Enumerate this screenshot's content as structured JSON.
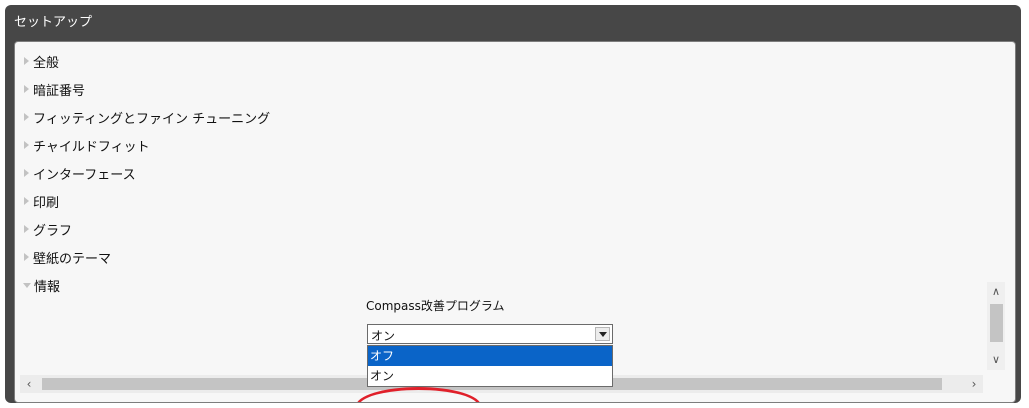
{
  "window": {
    "title": "セットアップ"
  },
  "menu": {
    "items": [
      {
        "label": "全般",
        "expanded": false
      },
      {
        "label": "暗証番号",
        "expanded": false
      },
      {
        "label": "フィッティングとファイン チューニング",
        "expanded": false
      },
      {
        "label": "チャイルドフィット",
        "expanded": false
      },
      {
        "label": "インターフェース",
        "expanded": false
      },
      {
        "label": "印刷",
        "expanded": false
      },
      {
        "label": "グラフ",
        "expanded": false
      },
      {
        "label": "壁紙のテーマ",
        "expanded": false
      },
      {
        "label": "情報",
        "expanded": true
      }
    ]
  },
  "info": {
    "program_label": "Compass改善プログラム",
    "select_value": "オン",
    "options": [
      "オフ",
      "オン"
    ],
    "highlighted_option": "オフ"
  },
  "colors": {
    "highlight": "#0a64c8",
    "annotation": "#e0202a"
  },
  "icons": {
    "collapsed": "triangle-right-icon",
    "expanded": "triangle-down-icon"
  }
}
